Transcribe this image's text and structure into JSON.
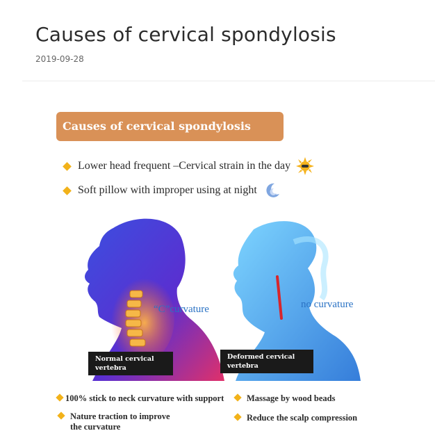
{
  "post": {
    "title": "Causes of cervical spondylosis",
    "date": "2019-09-28"
  },
  "infographic": {
    "banner_title": "Causes of cervical spondylosis",
    "causes": [
      {
        "text": "Lower head frequent –Cervical strain in the day",
        "icon": "sun-icon"
      },
      {
        "text": "Soft pillow with improper using at night",
        "icon": "moon-icon"
      }
    ],
    "normal": {
      "callout": "“C”curvature",
      "caption_line1": "Normal cervical",
      "caption_line2": "vertebra"
    },
    "deformed": {
      "callout": "no curvature",
      "caption_line1": "Deformed cervical",
      "caption_line2": "vertebra"
    },
    "features": [
      {
        "line1": "100% stick to neck curvature with  support",
        "line2": ""
      },
      {
        "line1": "Massage by wood beads",
        "line2": ""
      },
      {
        "line1": "Nature traction to improve",
        "line2": "the curvature"
      },
      {
        "line1": "Reduce the scalp compression",
        "line2": ""
      }
    ],
    "colors": {
      "banner": "#d99157",
      "bullet": "#f2b21a",
      "callout": "#2a72c4",
      "spine_normal": "#f5a53a",
      "spine_deformed": "#d7262c"
    }
  }
}
